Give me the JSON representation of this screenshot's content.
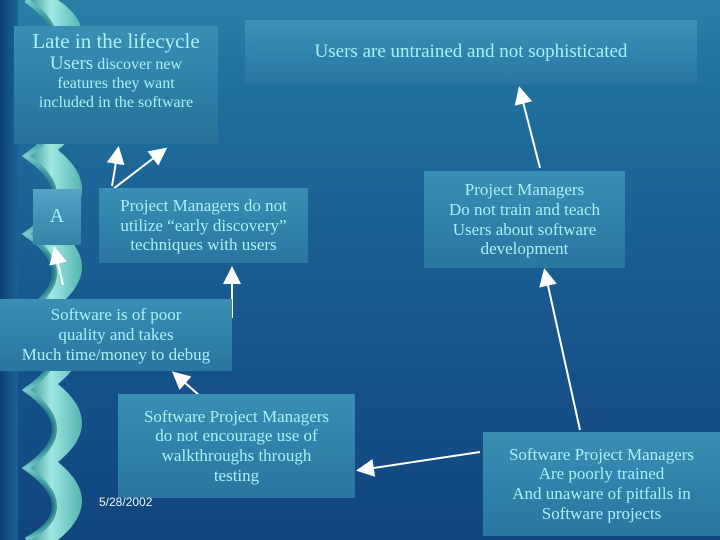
{
  "slide": {
    "date": "5/28/2002"
  },
  "boxes": {
    "late_lifecycle": {
      "line1": "Late in the lifecycle",
      "line2_strong": "Users",
      "line2_rest": " discover new",
      "line3": "features they want",
      "line4": "included in the software"
    },
    "untrained": {
      "text": "Users are untrained and not sophisticated"
    },
    "node_a": {
      "label": "A"
    },
    "pm_early_discovery": {
      "line1": "Project Managers do not",
      "line2": "utilize “early discovery”",
      "line3": "techniques with users"
    },
    "pm_no_train": {
      "line1": "Project Managers",
      "line2": "Do not train and teach",
      "line3": "Users about software",
      "line4": "development"
    },
    "poor_quality": {
      "line1": "Software is of poor",
      "line2": "quality and takes",
      "line3": "Much time/money to debug"
    },
    "walkthroughs": {
      "line1": "Software Project Managers",
      "line2": "do not encourage use of",
      "line3": "walkthroughs through",
      "line4": "testing"
    },
    "poorly_trained": {
      "line1": "Software Project Managers",
      "line2": "Are poorly trained",
      "line3": "And unaware of pitfalls in",
      "line4": "Software projects"
    }
  },
  "colors": {
    "background_top": "#2a7fa8",
    "background_bottom": "#11457e",
    "box_fill": "#2f82ab",
    "text": "#a8f0f6",
    "arrow": "#ffffff",
    "ribbon_light": "#9fe8e0",
    "ribbon_dark": "#2f8f90"
  }
}
